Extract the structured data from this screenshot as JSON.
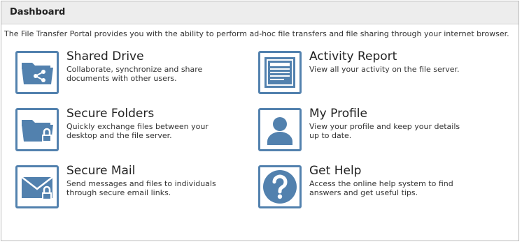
{
  "dashboard": {
    "title": "Dashboard",
    "intro": "The File Transfer Portal provides you with the ability to perform ad-hoc file transfers and file sharing through your internet browser.",
    "accent_color": "#5281ae",
    "tiles": [
      {
        "title": "Shared Drive",
        "description": "Collaborate, synchronize and share documents with other users.",
        "icon": "shared-folder-icon"
      },
      {
        "title": "Activity Report",
        "description": "View all your activity on the file server.",
        "icon": "report-document-icon"
      },
      {
        "title": "Secure Folders",
        "description": "Quickly exchange files between your desktop and the file server.",
        "icon": "locked-folder-icon"
      },
      {
        "title": "My Profile",
        "description": "View your profile and keep your details up to date.",
        "icon": "user-profile-icon"
      },
      {
        "title": "Secure Mail",
        "description": "Send messages and files to individuals through secure email links.",
        "icon": "secure-mail-icon"
      },
      {
        "title": "Get Help",
        "description": "Access the online help system to find answers and get useful tips.",
        "icon": "help-question-icon"
      }
    ]
  }
}
